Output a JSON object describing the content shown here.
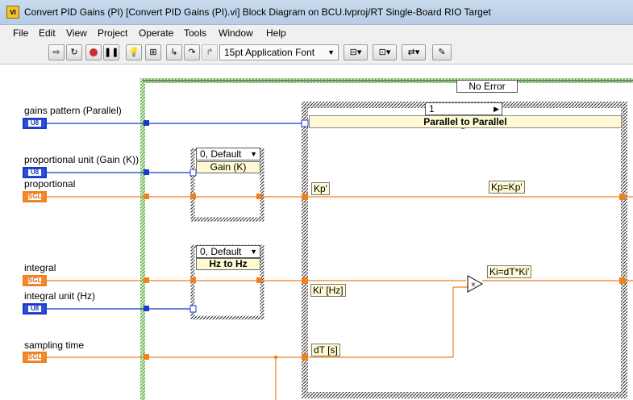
{
  "window": {
    "title": "Convert PID Gains (PI) [Convert PID Gains (PI).vi] Block Diagram on BCU.lvproj/RT Single-Board RIO Target",
    "icon": "labview-vi-icon"
  },
  "menu": [
    "File",
    "Edit",
    "View",
    "Project",
    "Operate",
    "Tools",
    "Window",
    "Help"
  ],
  "toolbar": {
    "buttons": [
      "run-continuously-icon",
      "run-icon",
      "abort-icon",
      "pause-icon",
      "highlight-execution-icon",
      "retain-wire-values-icon",
      "step-into-icon",
      "step-over-icon",
      "step-out-icon"
    ],
    "font_label": "15pt Application Font",
    "align_buttons": [
      "align-objects-icon",
      "distribute-objects-icon",
      "reorder-icon",
      "cleanup-diagram-icon"
    ]
  },
  "diagram": {
    "error_case_label": "No Error",
    "inputs": [
      {
        "label": "gains pattern (Parallel)",
        "type": "U8"
      },
      {
        "label": "proportional unit (Gain (K))",
        "type": "U8"
      },
      {
        "label": "proportional",
        "type": "SGL"
      },
      {
        "label": "integral",
        "type": "SGL"
      },
      {
        "label": "integral unit (Hz)",
        "type": "U8"
      },
      {
        "label": "sampling time",
        "type": "SGL"
      }
    ],
    "case_gain": {
      "selector": "0, Default",
      "label": "Gain (K)"
    },
    "case_hz": {
      "selector": "0, Default",
      "label": "Hz to Hz"
    },
    "case_parallel": {
      "selector": "1",
      "label": "Parallel to Parallel"
    },
    "inner_labels": {
      "kp_in": "Kp'",
      "kp_formula": "Kp=Kp'",
      "ki_in": "Ki' [Hz]",
      "ki_formula": "Ki=dT*Ki'",
      "dt_in": "dT [s]"
    },
    "colors": {
      "u8_wire": "#1c38c9",
      "sgl_wire": "#f08020",
      "while_loop_border": "#4faa3a",
      "case_border": "#1a1a1a",
      "label_fill": "#fffad4"
    }
  }
}
